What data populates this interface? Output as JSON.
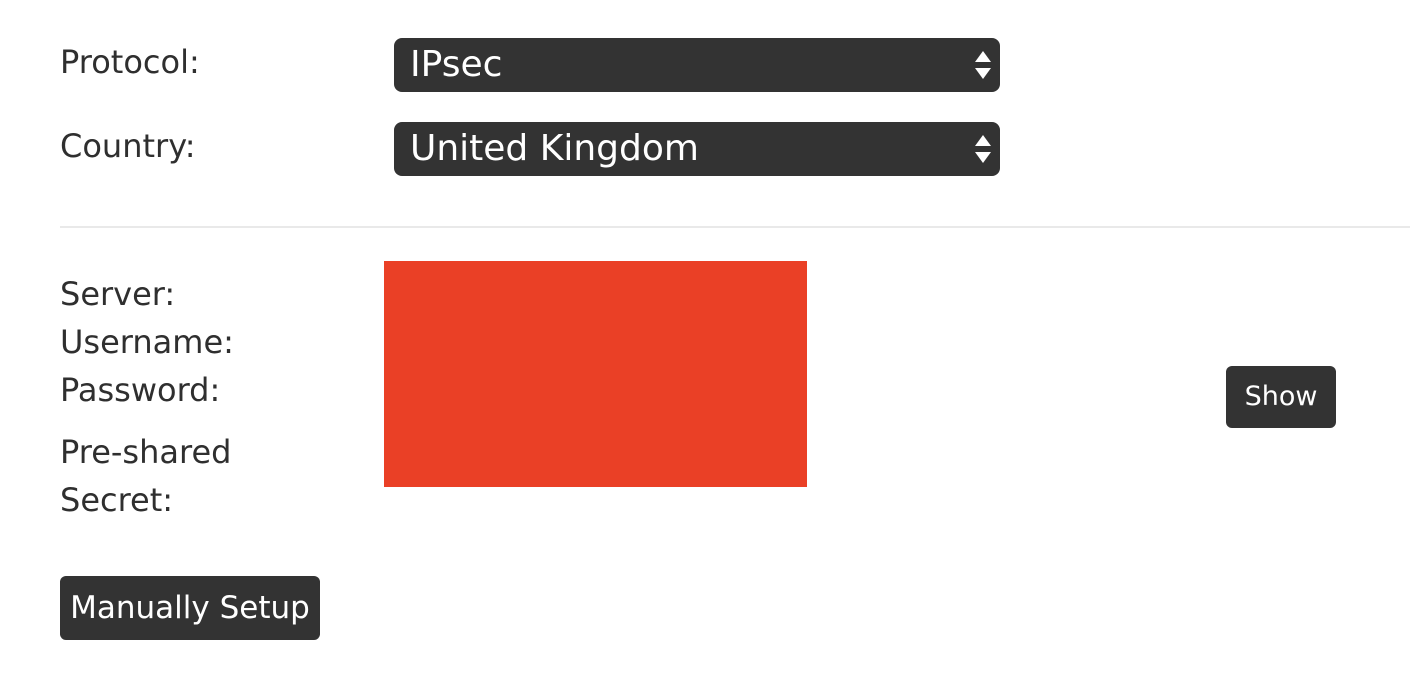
{
  "form": {
    "protocol_label": "Protocol:",
    "protocol_value": "IPsec",
    "country_label": "Country:",
    "country_value": "United Kingdom"
  },
  "credentials": {
    "server_label": "Server:",
    "username_label": "Username:",
    "password_label": "Password:",
    "preshared_line1": "Pre-shared",
    "preshared_line2": "Secret:",
    "show_button": "Show"
  },
  "actions": {
    "manual_setup_button": "Manually Setup"
  },
  "colors": {
    "control_bg": "#333333",
    "redaction": "#ea4026",
    "divider": "#e9e9e9",
    "text": "#2f2f2f"
  },
  "icons": {
    "select_arrows": "updown-arrows-icon"
  }
}
